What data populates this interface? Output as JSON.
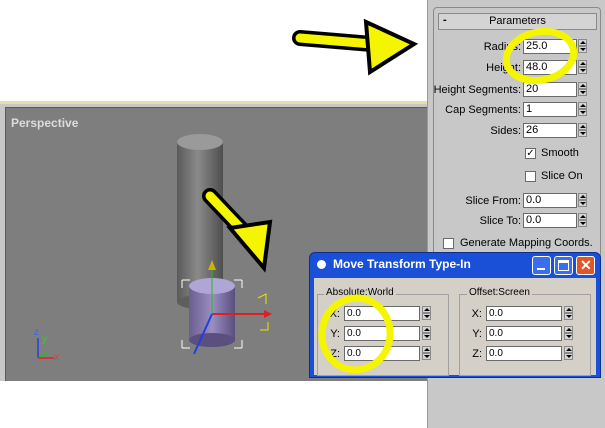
{
  "viewport": {
    "label": "Perspective"
  },
  "panel": {
    "rollout_title": "Parameters",
    "rollout_toggle": "-",
    "fields": [
      {
        "label": "Radius:",
        "value": "25.0"
      },
      {
        "label": "Height:",
        "value": "48.0"
      },
      {
        "label": "Height Segments:",
        "value": "20"
      },
      {
        "label": "Cap Segments:",
        "value": "1"
      },
      {
        "label": "Sides:",
        "value": "26"
      }
    ],
    "smooth": {
      "label": "Smooth",
      "checked": true,
      "mark": "✓"
    },
    "slice_on": {
      "label": "Slice On",
      "checked": false
    },
    "slice_from": {
      "label": "Slice From:",
      "value": "0.0"
    },
    "slice_to": {
      "label": "Slice To:",
      "value": "0.0"
    },
    "mapping": {
      "label": "Generate Mapping Coords.",
      "checked": false
    }
  },
  "dialog": {
    "title": "Move Transform Type-In",
    "absolute": {
      "title": "Absolute:World",
      "rows": [
        {
          "axis": "X:",
          "value": "0.0"
        },
        {
          "axis": "Y:",
          "value": "0.0"
        },
        {
          "axis": "Z:",
          "value": "0.0"
        }
      ]
    },
    "offset": {
      "title": "Offset:Screen",
      "rows": [
        {
          "axis": "X:",
          "value": "0.0"
        },
        {
          "axis": "Y:",
          "value": "0.0"
        },
        {
          "axis": "Z:",
          "value": "0.0"
        }
      ]
    }
  },
  "gizmo": {
    "x_label": "x",
    "y_label": "y",
    "z_label": "z"
  },
  "colors": {
    "highlight": "#f5f500",
    "titlebar": "#1a50d8",
    "panel": "#c8c8c8"
  }
}
